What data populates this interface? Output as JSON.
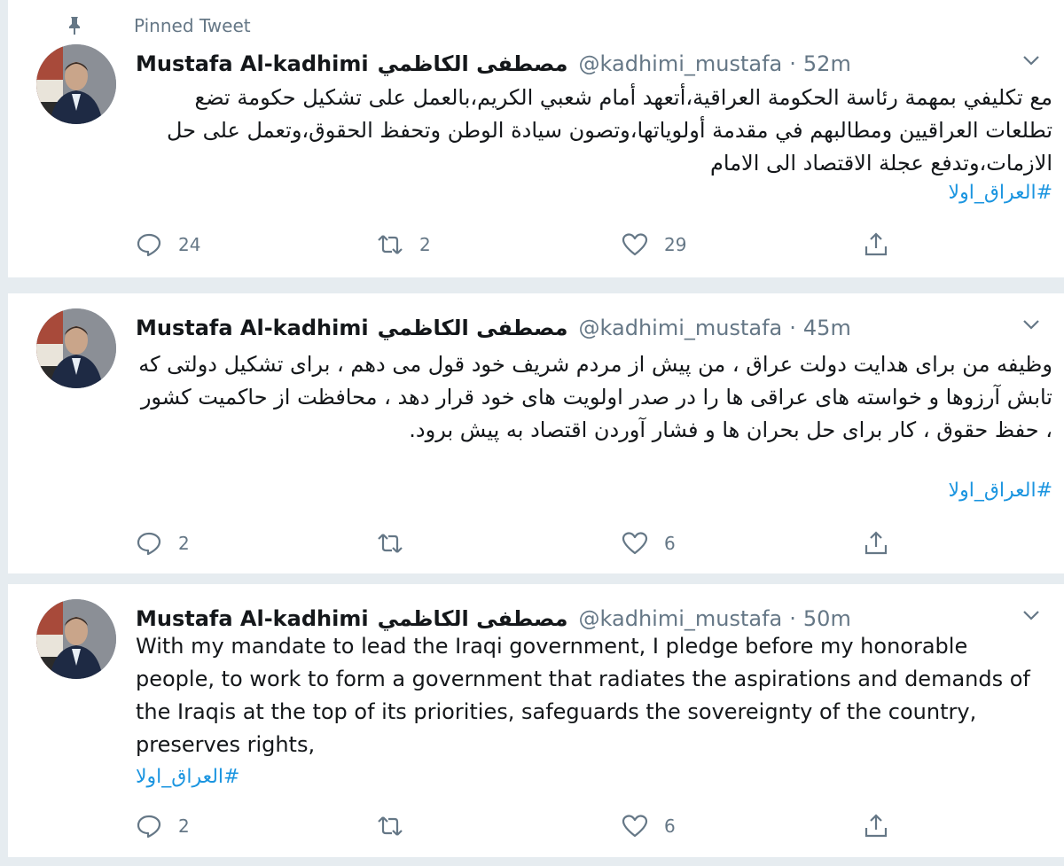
{
  "pinned_label": "Pinned Tweet",
  "tweets": [
    {
      "author_name": "Mustafa Al-kadhimi",
      "author_name_ar": "مصطفى الكاظمي",
      "handle": "@kadhimi_mustafa",
      "separator": "·",
      "time": "52m",
      "text": "مع تكليفي بمهمة رئاسة الحكومة العراقية،أتعهد أمام شعبي الكريم،بالعمل على تشكيل حكومة تضع تطلعات العراقيين ومطالبهم في مقدمة أولوياتها،وتصون سيادة الوطن وتحفظ الحقوق،وتعمل على حل الازمات،وتدفع عجلة الاقتصاد الى الامام",
      "hashtag": "#العراق_اولا",
      "reply_count": "24",
      "retweet_count": "2",
      "like_count": "29"
    },
    {
      "author_name": "Mustafa Al-kadhimi",
      "author_name_ar": "مصطفى الكاظمي",
      "handle": "@kadhimi_mustafa",
      "separator": "·",
      "time": "45m",
      "text": "وظیفه من برای هدایت دولت عراق ، من پیش از مردم شریف خود قول می دهم ، برای تشکیل دولتی که تابش آرزوها و خواسته های عراقی ها را در صدر اولویت های خود قرار دهد ، محافظت از حاکمیت کشور ، حفظ حقوق ، کار برای حل بحران ها و فشار آوردن اقتصاد به پیش برود.",
      "hashtag": "#العراق_اولا",
      "reply_count": "2",
      "retweet_count": "",
      "like_count": "6"
    },
    {
      "author_name": "Mustafa Al-kadhimi",
      "author_name_ar": "مصطفى الكاظمي",
      "handle": "@kadhimi_mustafa",
      "separator": "·",
      "time": "50m",
      "text": "With my mandate to lead the Iraqi government, I pledge before my honorable people, to work to form a government that radiates the aspirations and demands of the Iraqis at the top of its priorities, safeguards the sovereignty of the country, preserves rights,",
      "hashtag": "#العراق_اولا",
      "reply_count": "2",
      "retweet_count": "",
      "like_count": "6"
    }
  ]
}
